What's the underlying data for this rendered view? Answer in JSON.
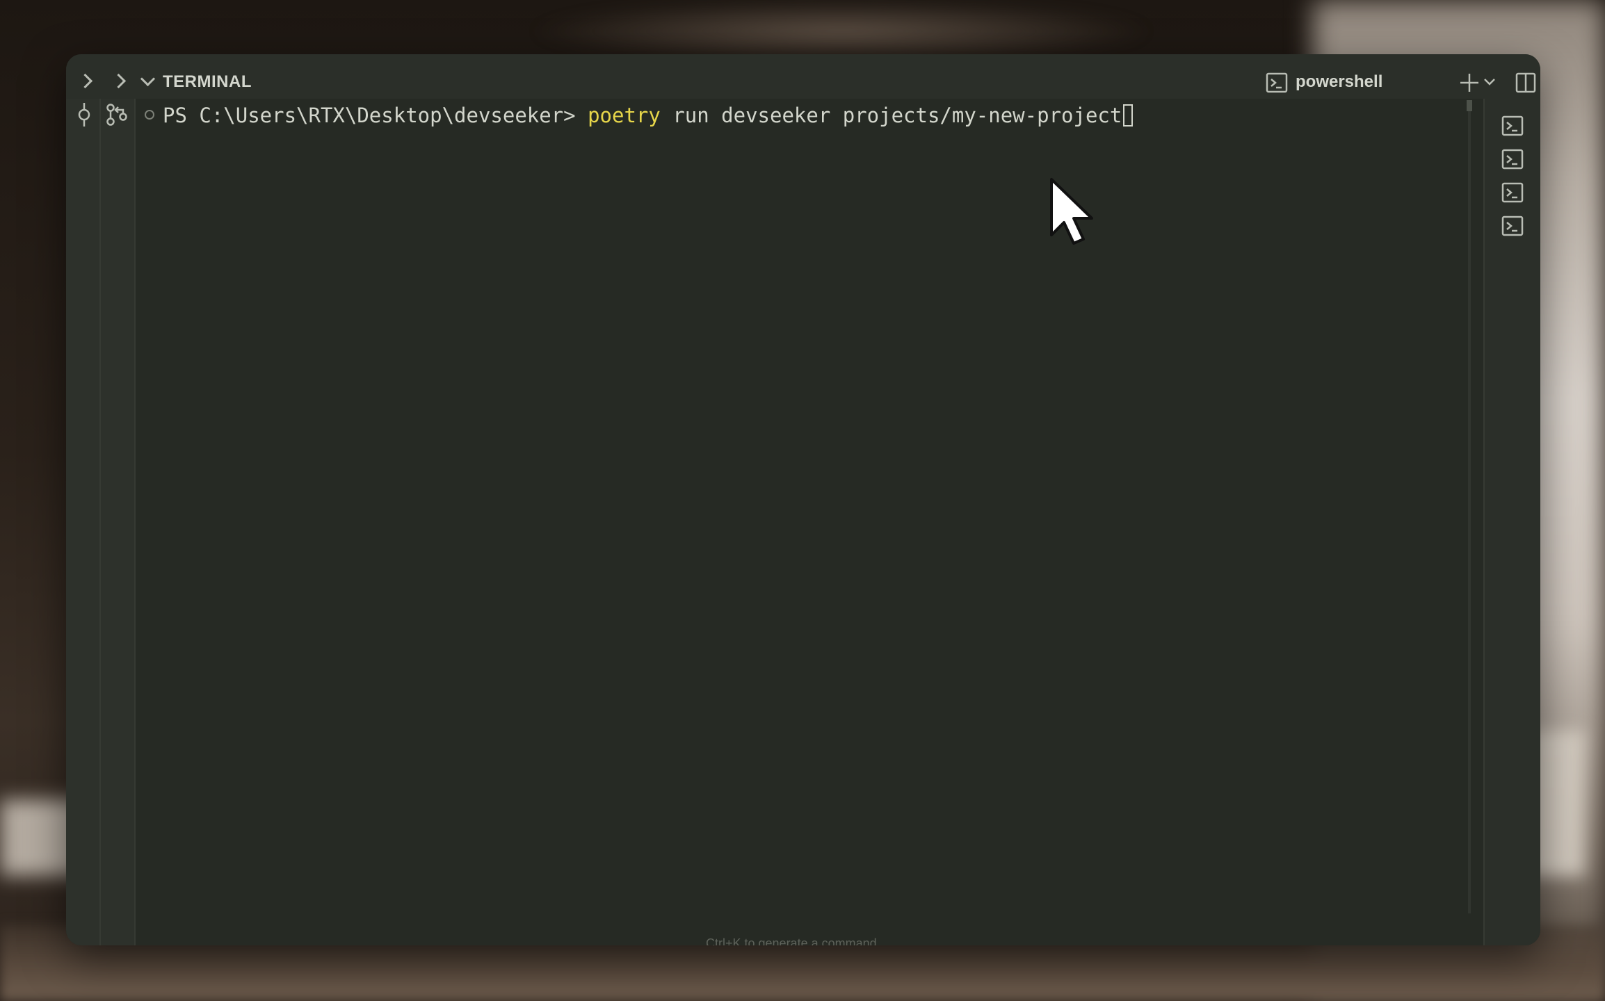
{
  "panel": {
    "title": "TERMINAL",
    "shell_name": "powershell"
  },
  "terminal": {
    "prompt": "PS C:\\Users\\RTX\\Desktop\\devseeker> ",
    "command_keyword": "poetry",
    "command_rest": " run devseeker projects/my-new-project",
    "hint": "Ctrl+K to generate a command"
  },
  "icons": {
    "expand_left": "chevron-right-icon",
    "expand_second": "chevron-right-icon",
    "collapse": "chevron-down-icon",
    "commit": "git-commit-icon",
    "compare": "git-compare-icon",
    "shell": "terminal-icon",
    "new_terminal": "plus-icon",
    "dropdown": "chevron-down-icon",
    "split": "split-icon",
    "trash": "trash-icon",
    "more": "more-icon"
  },
  "terminal_tabs": [
    "terminal-icon",
    "terminal-icon",
    "terminal-icon",
    "terminal-icon"
  ],
  "colors": {
    "panel_bg": "#262a24",
    "command_highlight": "#e7d64a",
    "text": "#d3d6cc"
  }
}
